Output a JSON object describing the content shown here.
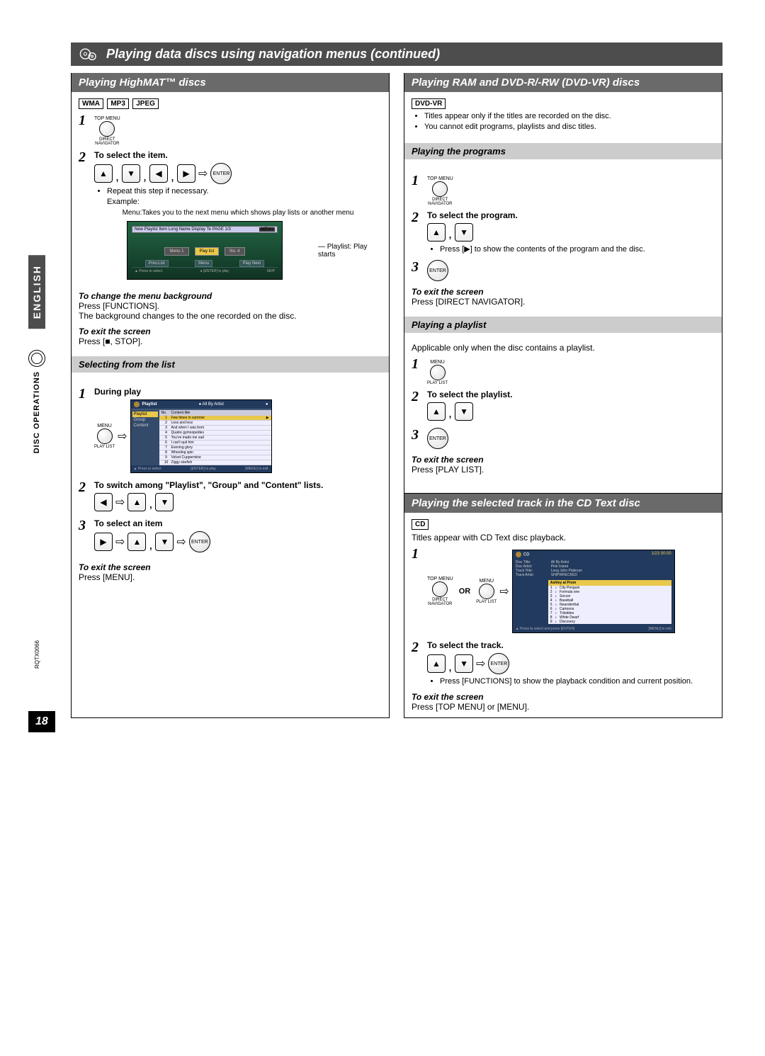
{
  "banner_title": "Playing data discs using navigation menus (continued)",
  "left": {
    "header": "Playing HighMAT™ discs",
    "formats": [
      "WMA",
      "MP3",
      "JPEG"
    ],
    "step1": {
      "top": "TOP MENU",
      "bot": "DIRECT\nNAVIGATOR"
    },
    "step2_title": "To select the item.",
    "step2_repeat": "Repeat this step if necessary.",
    "step2_example": "Example:",
    "enter": "ENTER",
    "annot_menu": "Menu:Takes you to the next menu which shows play lists or another menu",
    "annot_playlist": "Playlist: Play starts",
    "menu_shot": {
      "header": "New Playlist Item Long Name Display Te   PAGE 1/3",
      "menu": "Menu 1",
      "playlist": "Play list",
      "no": "No. 4",
      "bottom": [
        "Prev.List",
        "Menu",
        "Play Next"
      ],
      "foot_l": "▲ Press to select",
      "foot_m": "● [ENTER] to play",
      "foot_r": "SKIP"
    },
    "change_bg_h": "To change the menu background",
    "change_bg_1": "Press [FUNCTIONS].",
    "change_bg_2": "The background changes to the one recorded on the disc.",
    "exit1_h": "To exit the screen",
    "exit1_t": "Press [■, STOP].",
    "sub_selecting": "Selecting from the list",
    "sel_step1_title": "During play",
    "sel_step1_top": "MENU",
    "sel_step1_bot": "PLAY LIST",
    "list_shot": {
      "head_l": "Playlist",
      "head_r": "● All By Artist",
      "topbar": "",
      "side": [
        "Playlist",
        "Group",
        "Content"
      ],
      "cols": [
        "No.",
        "Content title"
      ],
      "rows": [
        [
          "1",
          "Few times in summer"
        ],
        [
          "2",
          "Less and less"
        ],
        [
          "3",
          "And when I was born"
        ],
        [
          "4",
          "Quatre gymnopedies"
        ],
        [
          "5",
          "You've made me sad"
        ],
        [
          "6",
          "I can't quit him"
        ],
        [
          "7",
          "Evening glory"
        ],
        [
          "8",
          "Wheeling spin"
        ],
        [
          "9",
          "Velvet Cuppermine"
        ],
        [
          "10",
          "Ziggy starfish"
        ]
      ],
      "foot_l": "▲ Press to select",
      "foot_m": "[ENTER] to play",
      "foot_r": "[MENU] to exit"
    },
    "sel_step2_title": "To switch among \"Playlist\", \"Group\" and \"Content\" lists.",
    "sel_step3_title": "To select an item",
    "exit3_h": "To exit the screen",
    "exit3_t": "Press [MENU]."
  },
  "right": {
    "header": "Playing RAM and DVD-R/-RW (DVD-VR) discs",
    "format": "DVD-VR",
    "bullets": [
      "Titles appear only if the titles are recorded on the disc.",
      "You cannot edit programs, playlists and disc titles."
    ],
    "sub_programs": "Playing the programs",
    "prog_step1": {
      "top": "TOP MENU",
      "bot": "DIRECT\nNAVIGATOR"
    },
    "prog_step2_title": "To select the program.",
    "prog_step2_note": "Press [▶] to show the contents of the program and the disc.",
    "enter": "ENTER",
    "prog_exit_h": "To exit the screen",
    "prog_exit_t": "Press [DIRECT NAVIGATOR].",
    "sub_playlist": "Playing a playlist",
    "pl_applicable": "Applicable only when the disc contains a playlist.",
    "pl_step1": {
      "top": "MENU",
      "bot": "PLAY LIST"
    },
    "pl_step2_title": "To select the playlist.",
    "pl_exit_h": "To exit the screen",
    "pl_exit_t": "Press [PLAY LIST].",
    "header2": "Playing the selected track in the CD Text disc",
    "cd_format": "CD",
    "cd_intro": "Titles appear with CD Text disc playback.",
    "cd_step1_a": {
      "top": "TOP MENU",
      "bot": "DIRECT\nNAVIGATOR"
    },
    "cd_or": "OR",
    "cd_step1_b": {
      "top": "MENU",
      "bot": "PLAY LIST"
    },
    "cd_shot": {
      "head_l": "CD",
      "head_r": "1/23  00:00",
      "info_l": [
        "Disc Title:",
        "Disc Artist:",
        "Track Title:",
        "Track Artist:"
      ],
      "info_r": [
        "All By Artist",
        "Pink Island",
        "Long John Platinum",
        "SHIPWRECKED"
      ],
      "list_head": "Ashley at Prom",
      "rows": [
        [
          "1",
          "City Penguin"
        ],
        [
          "2",
          "Formula one"
        ],
        [
          "3",
          "Soccer"
        ],
        [
          "4",
          "Baseball"
        ],
        [
          "5",
          "Neanderthal"
        ],
        [
          "6",
          "Cartoons"
        ],
        [
          "7",
          "Trilobites"
        ],
        [
          "8",
          "White Dwarf"
        ],
        [
          "9",
          "Discovery"
        ]
      ],
      "foot_l": "▲ Press to select and press [ENTER]",
      "foot_r": "[MENU] to exit"
    },
    "cd_step2_title": "To select the track.",
    "cd_step2_note": "Press [FUNCTIONS] to show the playback condition and current position.",
    "cd_exit_h": "To exit the screen",
    "cd_exit_t": "Press [TOP MENU] or [MENU]."
  },
  "side": {
    "english": "ENGLISH",
    "ops": "DISC OPERATIONS"
  },
  "page_number": "18",
  "doc_code": "RQTX0066",
  "chart_data": null
}
